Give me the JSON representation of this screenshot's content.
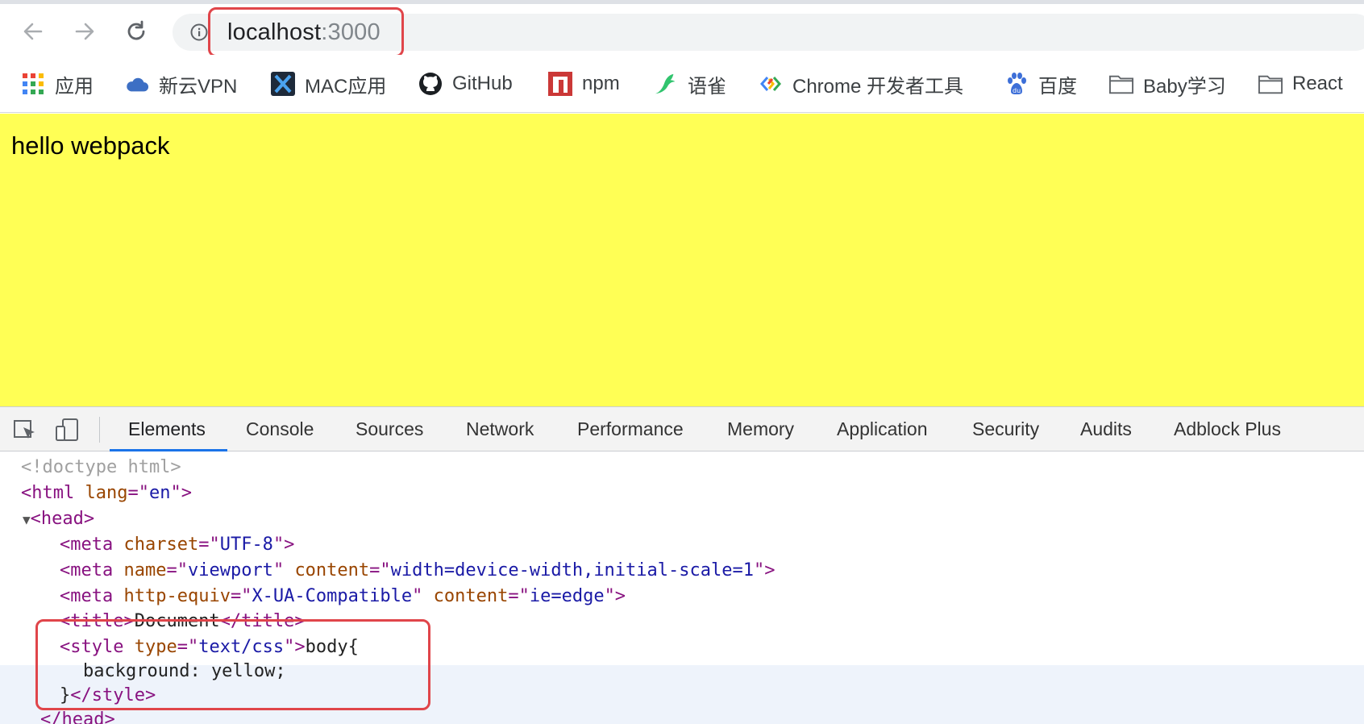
{
  "browser": {
    "url_host": "localhost",
    "url_port": ":3000"
  },
  "bookmarks": [
    {
      "label": "应用",
      "icon": "apps-grid-icon"
    },
    {
      "label": "新云VPN",
      "icon": "cloud-icon"
    },
    {
      "label": "MAC应用",
      "icon": "x-app-icon"
    },
    {
      "label": "GitHub",
      "icon": "github-icon"
    },
    {
      "label": "npm",
      "icon": "npm-icon"
    },
    {
      "label": "语雀",
      "icon": "yuque-bird-icon"
    },
    {
      "label": "Chrome 开发者工具",
      "icon": "chrome-devtools-icon"
    },
    {
      "label": "百度",
      "icon": "baidu-paw-icon"
    },
    {
      "label": "Baby学习",
      "icon": "folder-icon"
    },
    {
      "label": "React",
      "icon": "folder-icon"
    }
  ],
  "page": {
    "text": "hello webpack",
    "background": "#ffff55"
  },
  "devtools": {
    "tabs": [
      "Elements",
      "Console",
      "Sources",
      "Network",
      "Performance",
      "Memory",
      "Application",
      "Security",
      "Audits",
      "Adblock Plus"
    ],
    "active_tab": "Elements",
    "dom": {
      "doctype": "<!doctype html>",
      "html_tag": "html",
      "html_lang_attr": "lang",
      "html_lang_val": "en",
      "head_tag": "head",
      "meta1_attr": "charset",
      "meta1_val": "UTF-8",
      "meta2_attr1": "name",
      "meta2_val1": "viewport",
      "meta2_attr2": "content",
      "meta2_val2": "width=device-width,initial-scale=1",
      "meta3_attr1": "http-equiv",
      "meta3_val1": "X-UA-Compatible",
      "meta3_attr2": "content",
      "meta3_val2": "ie=edge",
      "title_text": "Document",
      "style_attr": "type",
      "style_val": "text/css",
      "style_line1": "body{",
      "style_line2": "background: yellow;",
      "style_line3": "}",
      "head_close": "head"
    }
  },
  "colors": {
    "highlight_border": "#e0454a",
    "active_tab_underline": "#1a73e8",
    "tag": "#881280",
    "attr": "#994500",
    "value": "#1a1aa6"
  }
}
